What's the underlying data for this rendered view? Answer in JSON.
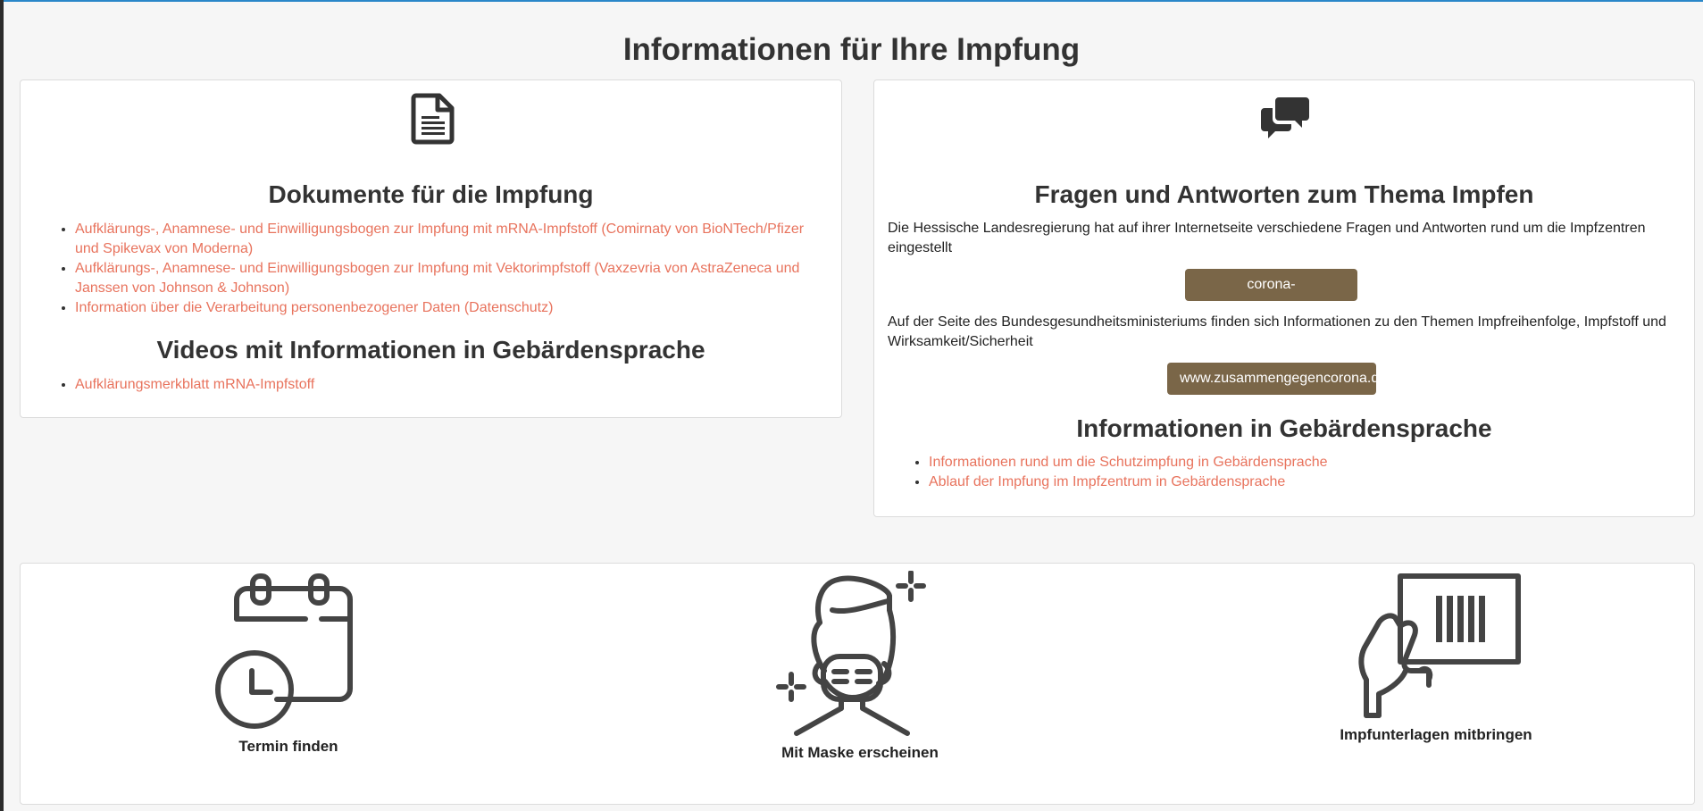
{
  "page": {
    "title": "Informationen für Ihre Impfung"
  },
  "documents": {
    "icon": "document-icon",
    "heading": "Dokumente für die Impfung",
    "links": [
      "Aufklärungs-, Anamnese- und Einwilligungsbogen zur Impfung mit mRNA-Impfstoff (Comirnaty von BioNTech/Pfizer und Spikevax von Moderna)",
      "Aufklärungs-, Anamnese- und Einwilligungsbogen zur Impfung mit Vektorimpfstoff (Vaxzevria von AstraZeneca und Janssen von Johnson & Johnson)",
      "Information über die Verarbeitung personenbezogener Daten (Datenschutz)"
    ]
  },
  "videos": {
    "heading": "Videos mit Informationen in Gebärdensprache",
    "links": [
      "Aufklärungsmerkblatt mRNA-Impfstoff"
    ]
  },
  "faq": {
    "icon": "chat-bubbles-icon",
    "heading": "Fragen und Antworten zum Thema Impfen",
    "text1": "Die Hessische Landesregierung hat auf ihrer Internetseite verschiedene Fragen und Antworten rund um die Impfzentren eingestellt",
    "button1": "corona-impfung.hessen.de/",
    "text2": "Auf der Seite des Bundesgesundheitsministeriums finden sich Informationen zu den Themen Impfreihenfolge, Impfstoff und Wirksamkeit/Sicherheit",
    "button2": "www.zusammengegencorona.de",
    "sign_heading": "Informationen in Gebärdensprache",
    "sign_links": [
      "Informationen rund um die Schutzimpfung in Gebärdensprache",
      "Ablauf der Impfung im Impfzentrum in Gebärdensprache"
    ]
  },
  "steps": [
    {
      "icon": "calendar-clock-icon",
      "label": "Termin finden"
    },
    {
      "icon": "masked-person-icon",
      "label": "Mit Maske erscheinen"
    },
    {
      "icon": "hand-holding-card-icon",
      "label": "Impfunterlagen mitbringen"
    }
  ],
  "colors": {
    "link": "#e8735d",
    "button": "#7a6648",
    "accent_top": "#2a87c9",
    "icon": "#444444"
  }
}
